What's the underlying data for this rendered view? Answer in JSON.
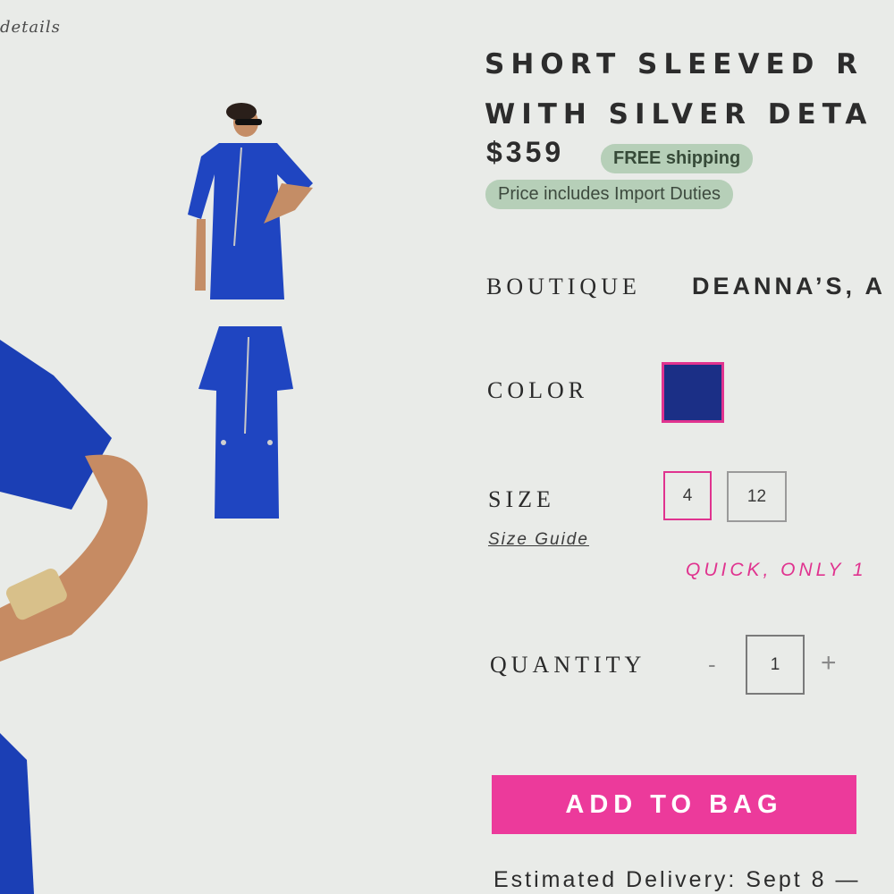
{
  "breadcrumb": "details",
  "product": {
    "title_line1": "SHORT SLEEVED R",
    "title_line2": "WITH SILVER DETA",
    "price": "$359",
    "shipping_badge": "FREE shipping",
    "duties_badge": "Price includes Import Duties"
  },
  "boutique": {
    "label": "BOUTIQUE",
    "name": "DEANNA’S, A"
  },
  "color": {
    "label": "COLOR",
    "selected_swatch": "#1b2f86"
  },
  "size": {
    "label": "SIZE",
    "guide_link": "Size Guide",
    "options": [
      "4",
      "12"
    ],
    "selected": "4",
    "stock_note": "QUICK, ONLY 1"
  },
  "quantity": {
    "label": "QUANTITY",
    "minus": "-",
    "value": "1",
    "plus": "+"
  },
  "cta": {
    "add_to_bag": "ADD TO BAG"
  },
  "delivery": {
    "text": "Estimated Delivery: Sept 8 —"
  },
  "colors": {
    "accent": "#ec3a9b",
    "badge_green": "#b6cfb8",
    "dress_blue": "#1b2f86"
  }
}
